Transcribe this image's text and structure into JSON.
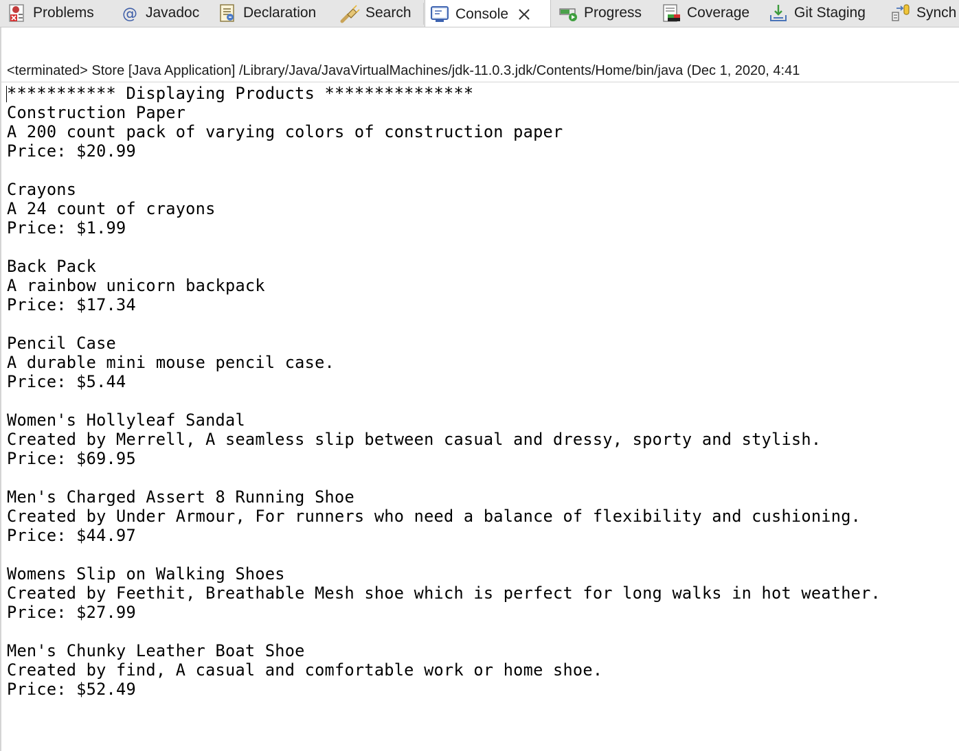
{
  "tabs": [
    {
      "label": "Problems",
      "icon": "problems-icon"
    },
    {
      "label": "Javadoc",
      "icon": "javadoc-at-icon"
    },
    {
      "label": "Declaration",
      "icon": "declaration-icon"
    },
    {
      "label": "Search",
      "icon": "search-flashlight-icon"
    },
    {
      "label": "Console",
      "icon": "console-icon",
      "active": true
    },
    {
      "label": "Progress",
      "icon": "progress-icon"
    },
    {
      "label": "Coverage",
      "icon": "coverage-icon"
    },
    {
      "label": "Git Staging",
      "icon": "git-staging-icon"
    },
    {
      "label": "Synch",
      "icon": "synchronize-icon"
    }
  ],
  "console": {
    "status": "<terminated> Store [Java Application] /Library/Java/JavaVirtualMachines/jdk-11.0.3.jdk/Contents/Home/bin/java (Dec 1, 2020, 4:41",
    "lines": [
      "*********** Displaying Products ***************",
      "Construction Paper",
      "A 200 count pack of varying colors of construction paper",
      "Price: $20.99",
      "",
      "Crayons",
      "A 24 count of crayons",
      "Price: $1.99",
      "",
      "Back Pack",
      "A rainbow unicorn backpack",
      "Price: $17.34",
      "",
      "Pencil Case",
      "A durable mini mouse pencil case.",
      "Price: $5.44",
      "",
      "Women's Hollyleaf Sandal",
      "Created by Merrell, A seamless slip between casual and dressy, sporty and stylish.",
      "Price: $69.95",
      "",
      "Men's Charged Assert 8 Running Shoe",
      "Created by Under Armour, For runners who need a balance of flexibility and cushioning.",
      "Price: $44.97",
      "",
      "Womens Slip on Walking Shoes",
      "Created by Feethit, Breathable Mesh shoe which is perfect for long walks in hot weather.",
      "Price: $27.99",
      "",
      "Men's Chunky Leather Boat Shoe",
      "Created by find, A casual and comfortable work or home shoe.",
      "Price: $52.49"
    ]
  },
  "colors": {
    "tabbar_bg": "#e6e6e6",
    "active_tab_bg": "#ffffff",
    "console_text": "#000000"
  }
}
